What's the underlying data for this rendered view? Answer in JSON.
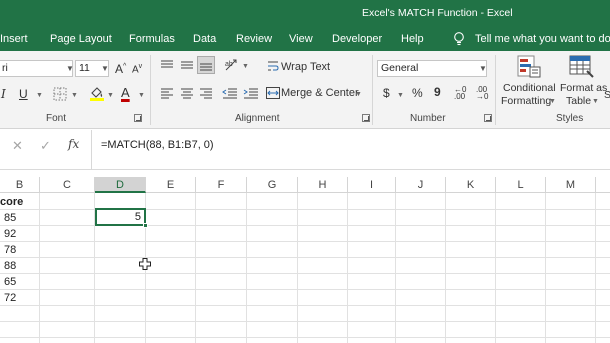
{
  "window": {
    "title": "Excel's MATCH Function  -  Excel"
  },
  "tabs": [
    "Insert",
    "Page Layout",
    "Formulas",
    "Data",
    "Review",
    "View",
    "Developer",
    "Help"
  ],
  "tell_me": "Tell me what you want to do",
  "ribbon": {
    "font": {
      "name": "ri",
      "size": "11",
      "group_label": "Font"
    },
    "alignment": {
      "wrap_text": "Wrap Text",
      "merge_center": "Merge & Center",
      "group_label": "Alignment"
    },
    "number": {
      "format": "General",
      "currency": "$",
      "percent": "%",
      "comma": "9",
      "group_label": "Number"
    },
    "styles": {
      "conditional_1": "Conditional",
      "conditional_2": "Formatting",
      "format_as_1": "Format as",
      "format_as_2": "Table",
      "cell_styles_cut": "S",
      "group_label": "Styles"
    }
  },
  "formula_bar": {
    "content": "=MATCH(88, B1:B7, 0)"
  },
  "columns": [
    "B",
    "C",
    "D",
    "E",
    "F",
    "G",
    "H",
    "I",
    "J",
    "K",
    "L",
    "M"
  ],
  "selected_column": "D",
  "cells": {
    "b_header": "core",
    "b_values": [
      "85",
      "92",
      "78",
      "88",
      "65",
      "72"
    ],
    "d2": "5"
  },
  "colors": {
    "excel_green": "#217346",
    "ribbon_bg": "#f3f3f3",
    "font_red": "#c00000",
    "highlight_yellow": "#ffff00"
  }
}
